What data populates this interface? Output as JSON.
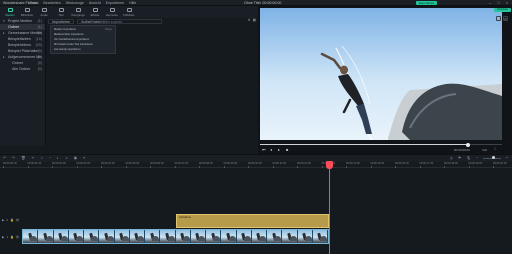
{
  "titlebar": {
    "app_name": "Wondershare Filmora",
    "menu": [
      "Datei",
      "Bearbeiten",
      "Werkzeuge",
      "Ansicht",
      "Exportieren",
      "Hilfe"
    ],
    "project_name": "Ohne Titel: 00:00:00:00",
    "export_label": "Exportieren"
  },
  "toolbar": {
    "items": [
      "Medien",
      "Bibliothek",
      "Audio",
      "Titel",
      "Übergänge",
      "Effekte",
      "Elemente",
      "Teilbildsc."
    ]
  },
  "sidebar": {
    "items": [
      {
        "label": "Projekt Medien",
        "count": "(1)",
        "caret": "▾"
      },
      {
        "label": "Ordner",
        "count": "(1)",
        "selected": true
      },
      {
        "label": "Gemeinsame Medien",
        "count": "(0)",
        "caret": "▸"
      },
      {
        "label": "Beispielfarben",
        "count": "(15)"
      },
      {
        "label": "Beispielvideos",
        "count": "(20)"
      },
      {
        "label": "Beispiel Platzhalter",
        "count": "(5)"
      },
      {
        "label": "Aufgenommenes Me..",
        "count": "(0)",
        "caret": "▸"
      },
      {
        "label": "Ordner",
        "count": "(0)",
        "sub": true
      },
      {
        "label": "Alle Ordner",
        "count": "(0)",
        "sub": true
      }
    ]
  },
  "media": {
    "tabs": [
      "Importieren",
      "Aufnehmen"
    ],
    "search_placeholder": "Medien suchen",
    "import_menu": [
      {
        "label": "Medien importieren",
        "hotkey": "Strg+I"
      },
      {
        "label": "Medienordner importieren",
        "hotkey": ""
      },
      {
        "label": "Von Gerät/Kamera importieren",
        "hotkey": ""
      },
      {
        "label": "Mit Instant Cutter Tool importieren",
        "hotkey": ""
      },
      {
        "label": "Aus Handy importieren",
        "hotkey": ""
      }
    ]
  },
  "preview": {
    "render_label": "Vorschau",
    "progress": 0.86,
    "time": "00:00:00:00",
    "quality": "Voll"
  },
  "timeline": {
    "ticks": [
      "00:00:00:00",
      "00:00:01:00",
      "00:00:02:00",
      "00:00:03:00",
      "00:00:04:00",
      "00:00:05:00",
      "00:00:06:00",
      "00:00:07:00",
      "00:00:08:00",
      "00:00:09:00",
      "00:00:10:00",
      "00:00:11:00",
      "00:00:12:00",
      "00:00:13:00",
      "00:00:14:00",
      "00:00:15:00",
      "00:00:16:00",
      "00:00:17:00",
      "00:00:18:00",
      "00:00:19:00",
      "00:00:20:00"
    ],
    "audio_clip_label": "Aufnahme",
    "track_labels": [
      "2",
      "1"
    ]
  }
}
